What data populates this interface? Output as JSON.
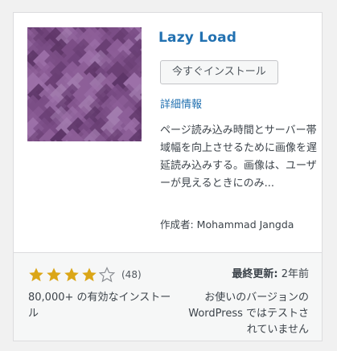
{
  "plugin": {
    "name": "Lazy Load",
    "install_button": "今すぐインストール",
    "details_link": "詳細情報",
    "description": "ページ読み込み時間とサーバー帯域幅を向上させるために画像を遅延読み込みする。画像は、ユーザーが見えるときにのみ...",
    "author": "作成者: Mohammad Jangda",
    "thumbnail_colors": [
      "#6a3f74",
      "#7b4e86",
      "#8d5f98",
      "#9c70a8",
      "#5d3567",
      "#a27cae"
    ]
  },
  "footer": {
    "rating": 4,
    "rating_max": 5,
    "rating_count": "(48)",
    "installs": "80,000+ の有効なインストール",
    "last_updated_label": "最終更新:",
    "last_updated_value": " 2年前",
    "compatibility": "お使いのバージョンの WordPress ではテストされていません",
    "star_color": "#dba617",
    "star_empty_color": "#8c8f94"
  },
  "colors": {
    "link": "#2271b1",
    "text": "#3c434a"
  }
}
